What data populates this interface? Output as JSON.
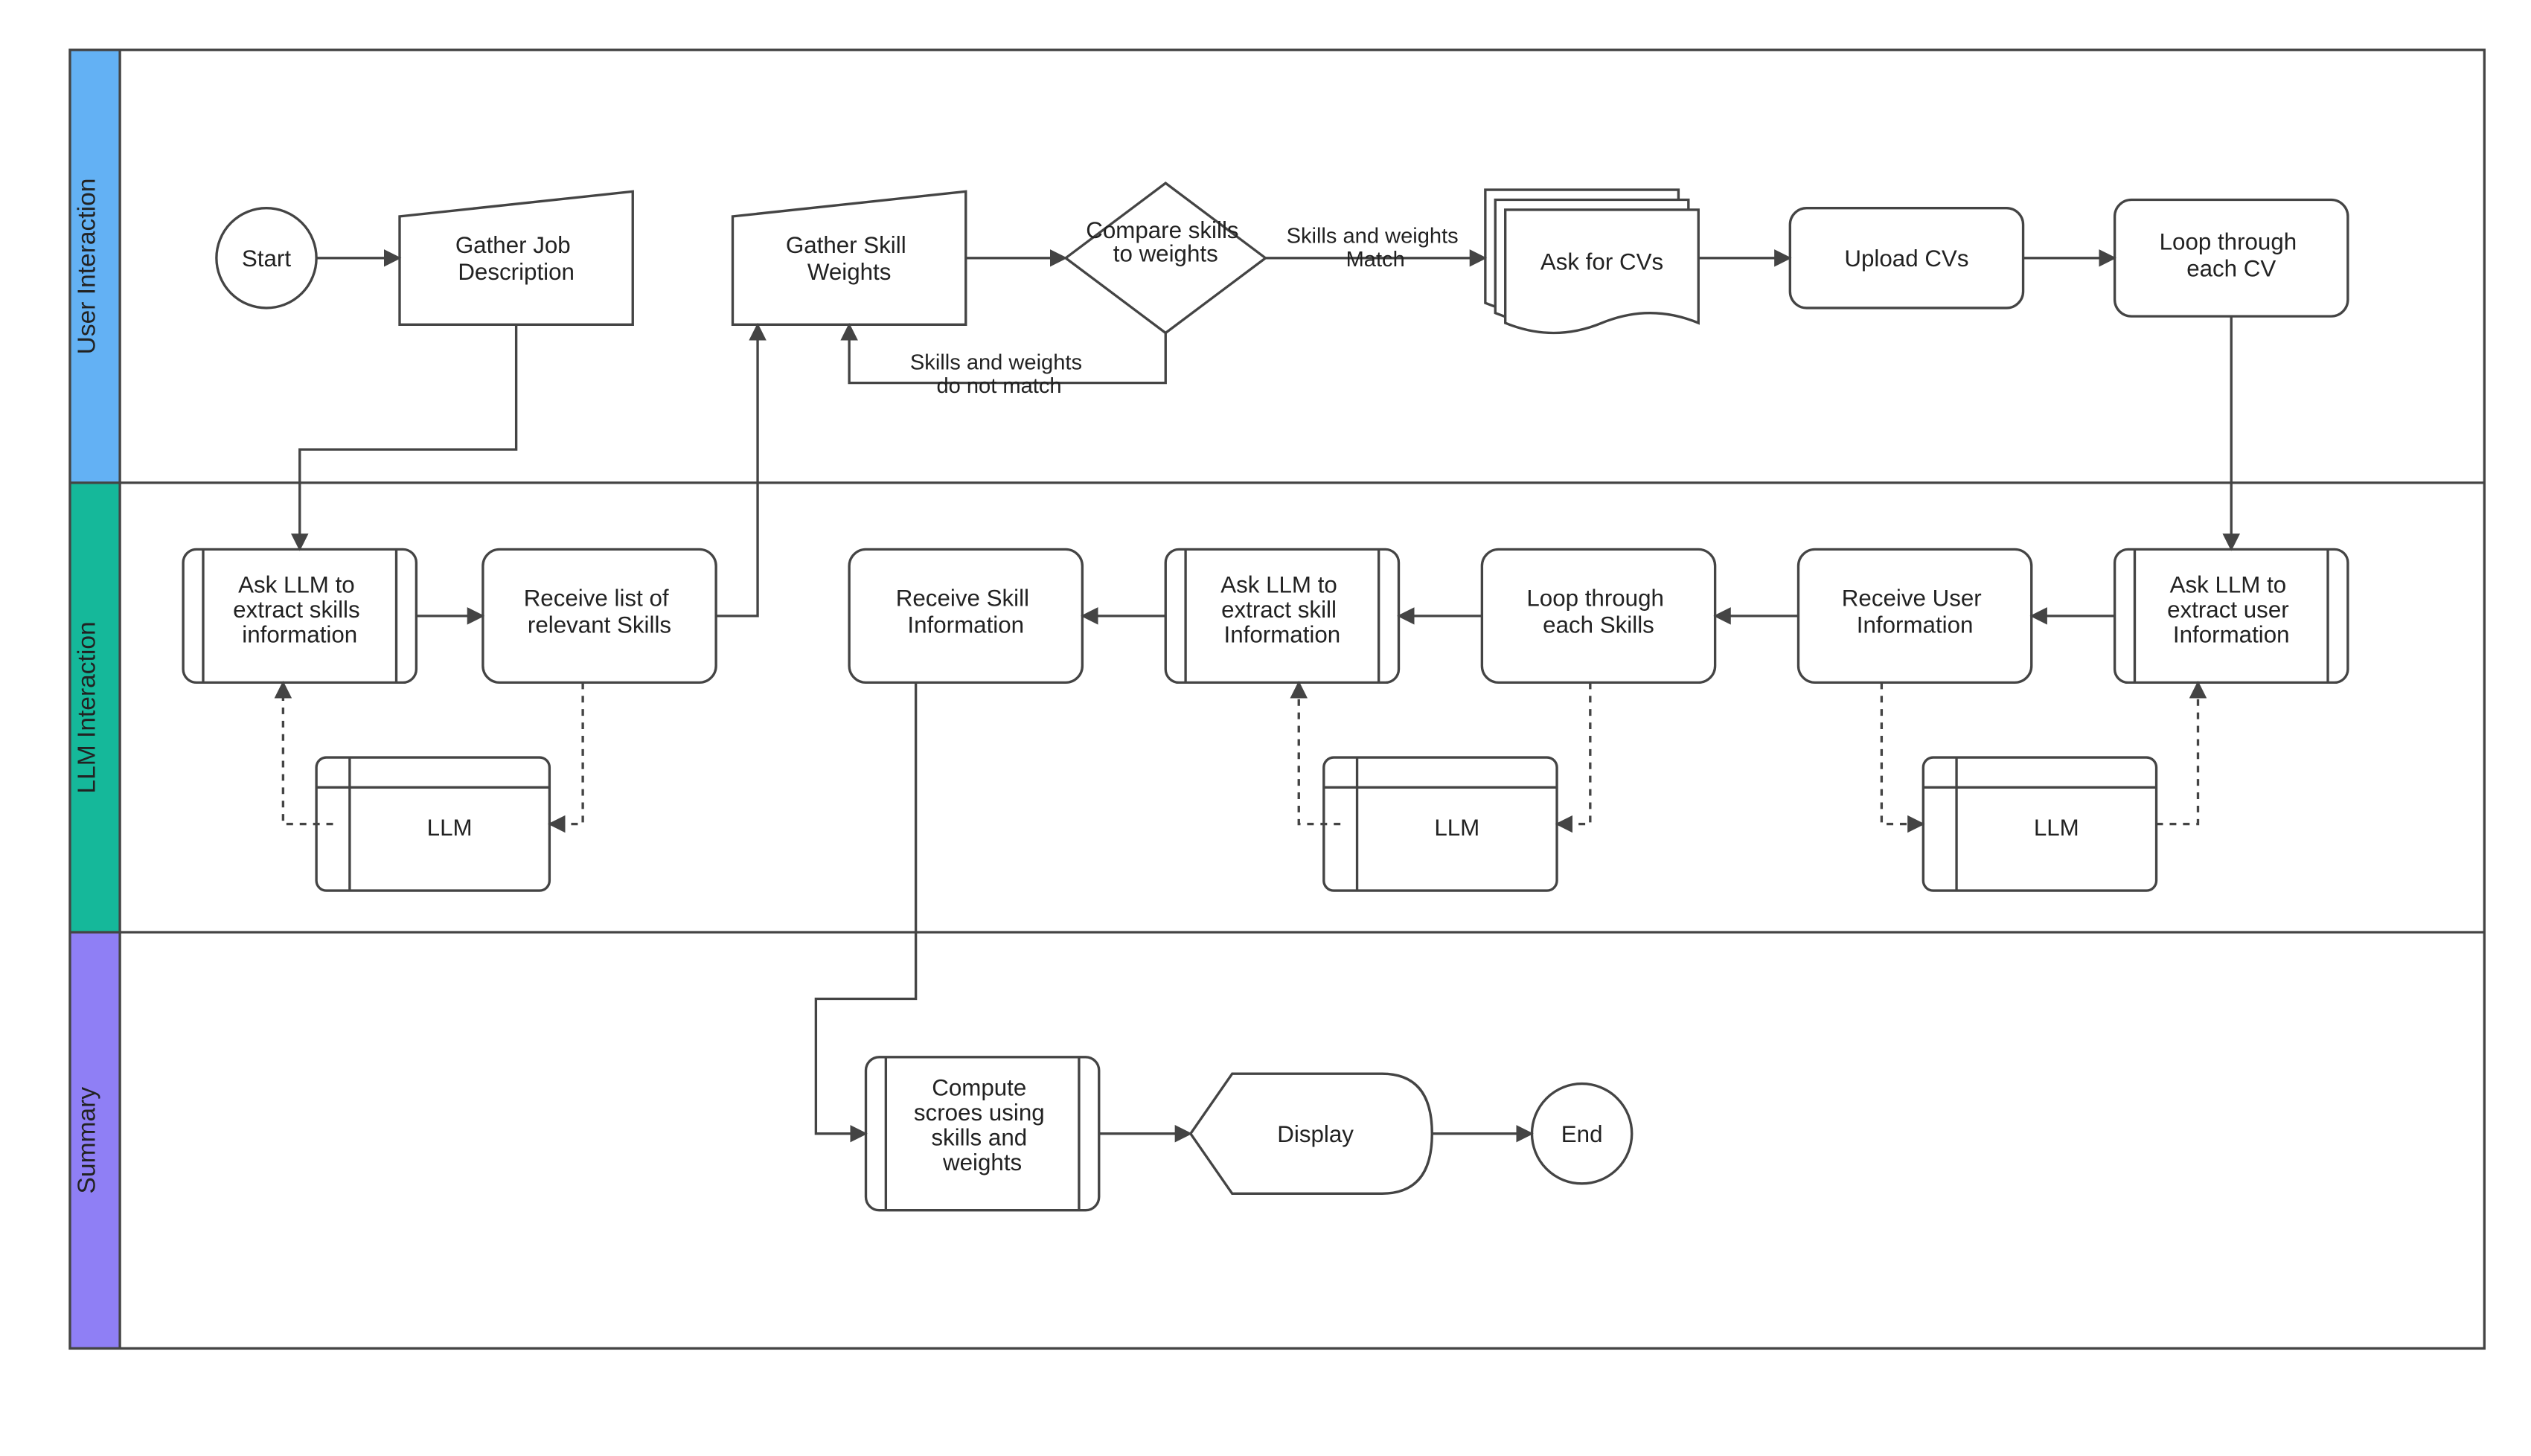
{
  "lanes": {
    "user": {
      "label": "User Interaction",
      "color": "#63B1F4"
    },
    "llm": {
      "label": "LLM Interaction",
      "color": "#15B89A"
    },
    "summary": {
      "label": "Summary",
      "color": "#8F7FF5"
    }
  },
  "nodes": {
    "start": {
      "label": "Start"
    },
    "gather_jd": {
      "label": "Gather Job Description"
    },
    "gather_weights": {
      "label": "Gather Skill Weights"
    },
    "compare": {
      "label": "Compare skills to weights"
    },
    "ask_cvs": {
      "label": "Ask for CVs"
    },
    "upload_cvs": {
      "label": "Upload CVs"
    },
    "loop_cvs": {
      "label": "Loop through each CV"
    },
    "ask_extract_skills": {
      "label": "Ask LLM to extract skills information"
    },
    "recv_skills_list": {
      "label": "Receive list of relevant Skills"
    },
    "llm_box_1": {
      "label": "LLM"
    },
    "ask_extract_user": {
      "label": "Ask LLM to extract user Information"
    },
    "recv_user_info": {
      "label": "Receive User Information"
    },
    "loop_skills": {
      "label": "Loop through each Skills"
    },
    "ask_extract_skill": {
      "label": "Ask LLM to extract skill Information"
    },
    "recv_skill_info": {
      "label": "Receive Skill Information"
    },
    "llm_box_2": {
      "label": "LLM"
    },
    "llm_box_3": {
      "label": "LLM"
    },
    "compute_scores": {
      "label": "Compute scroes using skills and weights"
    },
    "display": {
      "label": "Display"
    },
    "end": {
      "label": "End"
    }
  },
  "edge_labels": {
    "match": "Skills and weights Match",
    "no_match": "Skills and weights do not match"
  }
}
